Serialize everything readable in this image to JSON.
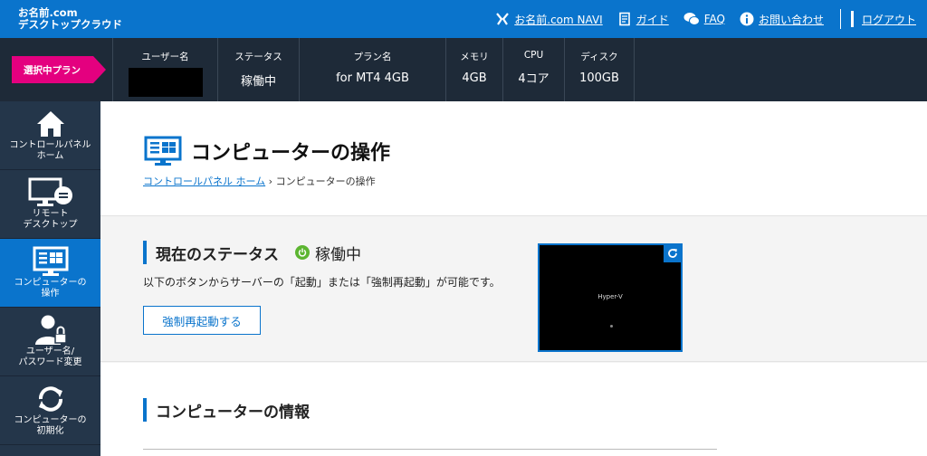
{
  "header": {
    "brand_line1": "お名前.com",
    "brand_line2": "デスクトップクラウド",
    "nav": [
      {
        "icon": "navi-icon",
        "label": "お名前.com NAVI"
      },
      {
        "icon": "guide-icon",
        "label": "ガイド"
      },
      {
        "icon": "faq-icon",
        "label": "FAQ"
      },
      {
        "icon": "info-icon",
        "label": "お問い合わせ"
      },
      {
        "icon": "logout-icon",
        "label": "ログアウト"
      }
    ]
  },
  "plan": {
    "badge": "選択中プラン",
    "username_header": "ユーザー名",
    "status_header": "ステータス",
    "status_value": "稼働中",
    "plan_header": "プラン名",
    "plan_value": "for MT4 4GB",
    "memory_header": "メモリ",
    "memory_value": "4GB",
    "cpu_header": "CPU",
    "cpu_value": "4コア",
    "disk_header": "ディスク",
    "disk_value": "100GB"
  },
  "sidebar": {
    "items": [
      {
        "icon": "home-icon",
        "label": "コントロールパネル\nホーム"
      },
      {
        "icon": "remote-desktop-icon",
        "label": "リモート\nデスクトップ"
      },
      {
        "icon": "computer-icon",
        "label": "コンピューターの\n操作"
      },
      {
        "icon": "user-lock-icon",
        "label": "ユーザー名/\nパスワード変更"
      },
      {
        "icon": "reset-icon",
        "label": "コンピューターの\n初期化"
      }
    ]
  },
  "main": {
    "title": "コンピューターの操作",
    "breadcrumb_link": "コントロールパネル ホーム",
    "breadcrumb_sep": "›",
    "breadcrumb_current": "コンピューターの操作",
    "status_heading": "現在のステータス",
    "status_value": "稼働中",
    "status_desc": "以下のボタンからサーバーの「起動」または「強制再起動」が可能です。",
    "restart_label": "強制再起動する",
    "preview_text": "Hyper-V",
    "info_heading": "コンピューターの情報"
  },
  "colors": {
    "accent": "#0a74cc",
    "badge": "#e4007f",
    "planbar": "#1e2a38",
    "sidebar": "#24364a",
    "status_ok": "#5cb531"
  }
}
